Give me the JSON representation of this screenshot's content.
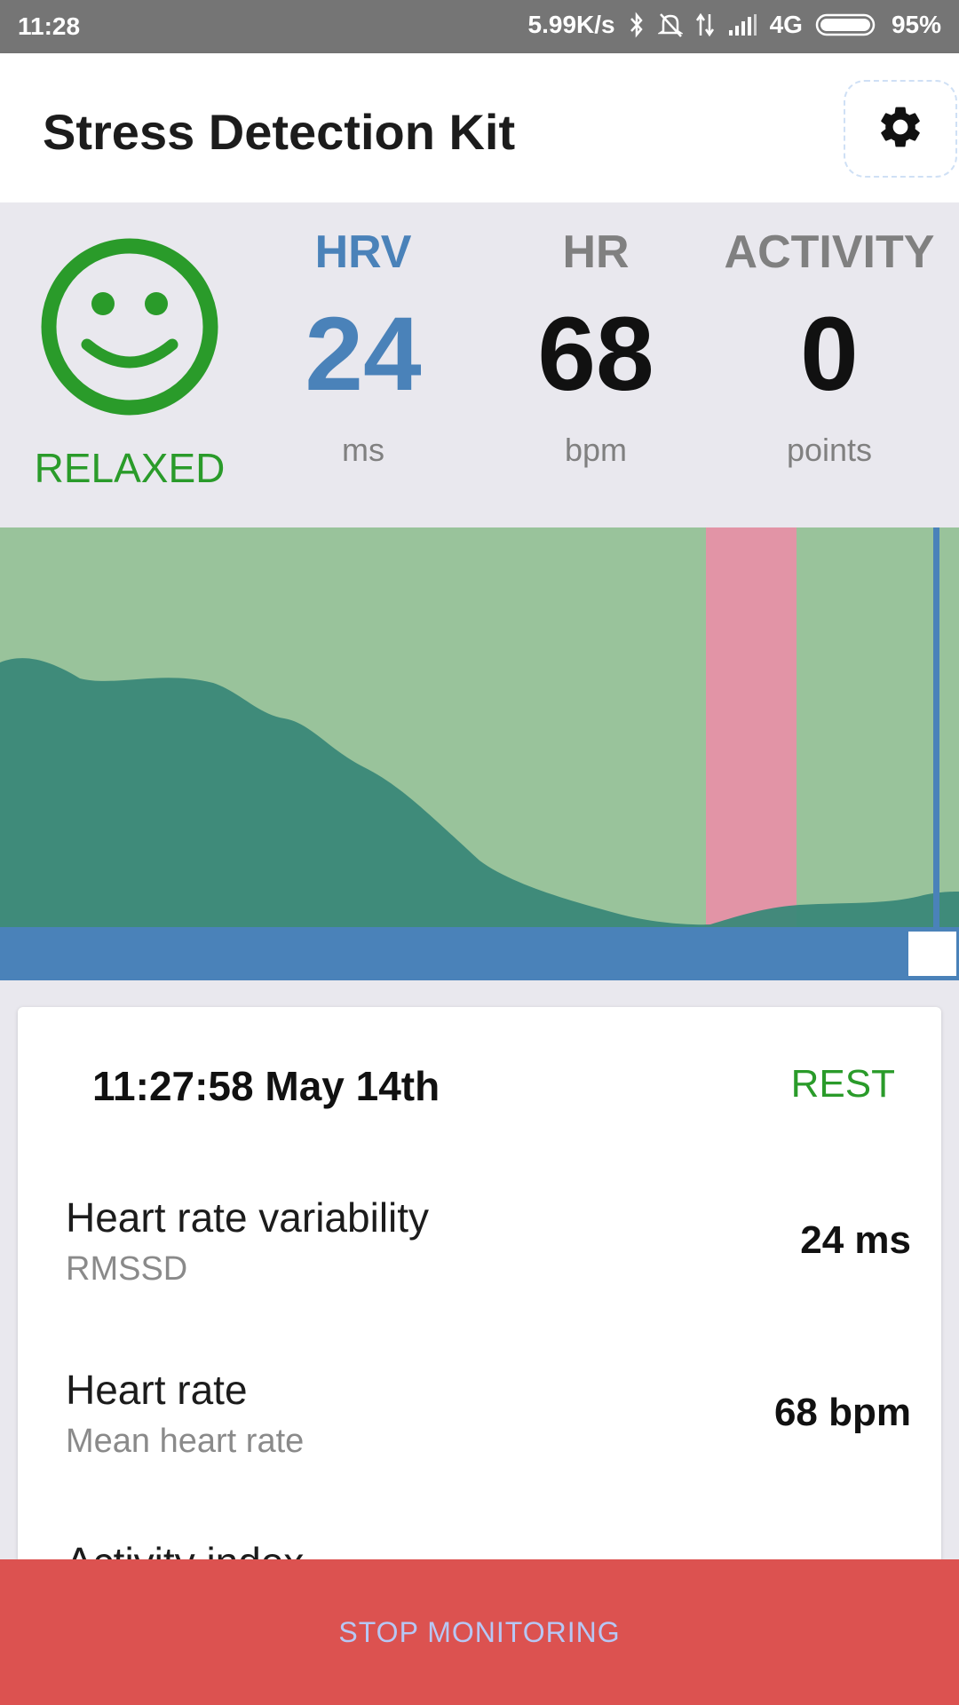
{
  "status_bar": {
    "time": "11:28",
    "network_speed": "5.99K/s",
    "network_type": "4G",
    "battery": "95%",
    "icons": [
      "bluetooth-icon",
      "bell-off-icon",
      "data-transfer-icon",
      "signal-icon",
      "battery-icon"
    ]
  },
  "app_bar": {
    "title": "Stress Detection Kit",
    "settings_icon": "gear-icon"
  },
  "summary": {
    "mood_icon": "smiley-face-icon",
    "mood_label": "RELAXED",
    "metrics": [
      {
        "label": "HRV",
        "value": "24",
        "unit": "ms"
      },
      {
        "label": "HR",
        "value": "68",
        "unit": "bpm"
      },
      {
        "label": "ACTIVITY",
        "value": "0",
        "unit": "points"
      }
    ]
  },
  "colors": {
    "accent_blue": "#4a82b9",
    "relaxed_green": "#2a9b2a",
    "chart_background": "#99c39b",
    "hrv_area": "#3a8878",
    "stress_band": "#e294a6",
    "stop_button": "#dc5250"
  },
  "detail_card": {
    "timestamp": "11:27:58 May 14th",
    "state": "REST",
    "rows": [
      {
        "name": "Heart rate variability",
        "sub": "RMSSD",
        "value": "24 ms"
      },
      {
        "name": "Heart rate",
        "sub": "Mean heart rate",
        "value": "68 bpm"
      },
      {
        "name": "Activity index",
        "sub": "",
        "value": ""
      }
    ]
  },
  "stop_button": {
    "label": "STOP MONITORING"
  }
}
